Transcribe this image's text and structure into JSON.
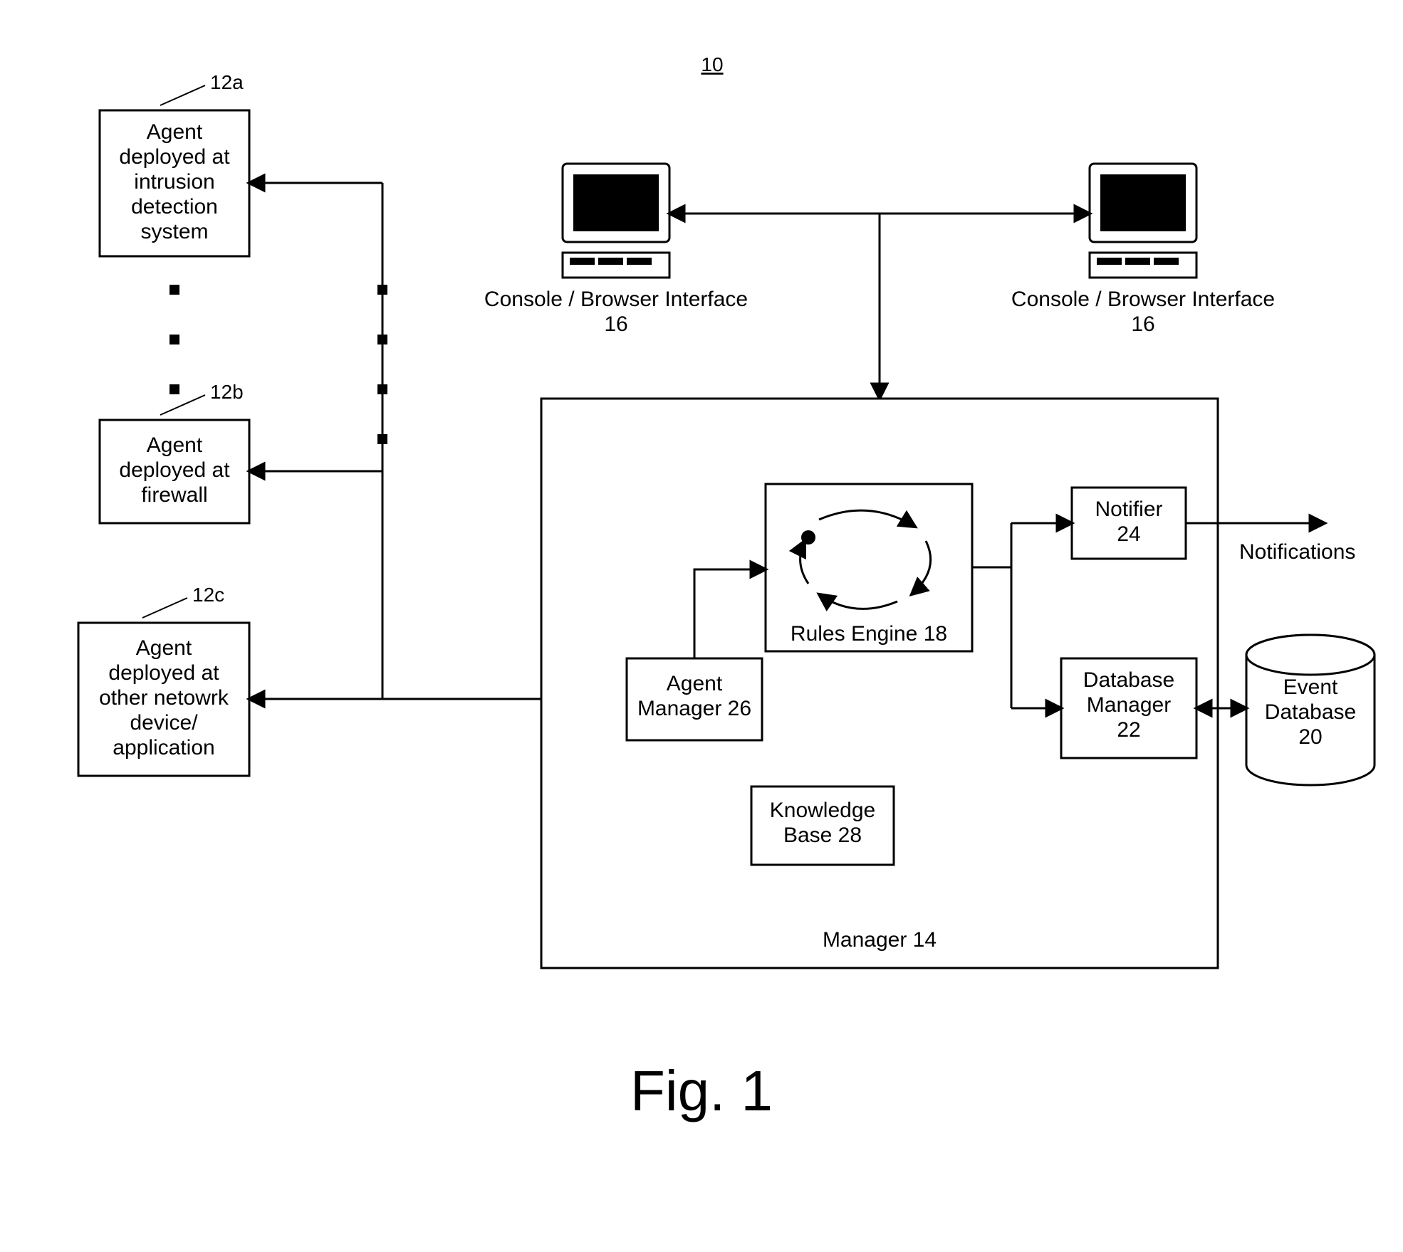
{
  "figure_num_ref": "10",
  "figure_caption": "Fig. 1",
  "agents": {
    "a": {
      "ref": "12a",
      "l1": "Agent",
      "l2": "deployed at",
      "l3": "intrusion",
      "l4": "detection",
      "l5": "system"
    },
    "b": {
      "ref": "12b",
      "l1": "Agent",
      "l2": "deployed at",
      "l3": "firewall"
    },
    "c": {
      "ref": "12c",
      "l1": "Agent",
      "l2": "deployed at",
      "l3": "other netowrk",
      "l4": "device/",
      "l5": "application"
    }
  },
  "consoles": {
    "left": {
      "l1": "Console / Browser Interface",
      "l2": "16"
    },
    "right": {
      "l1": "Console / Browser Interface",
      "l2": "16"
    }
  },
  "manager": {
    "label": "Manager 14",
    "agent_manager": {
      "l1": "Agent",
      "l2": "Manager 26"
    },
    "rules_engine": {
      "label": "Rules Engine 18"
    },
    "notifier": {
      "l1": "Notifier",
      "l2": "24"
    },
    "db_manager": {
      "l1": "Database",
      "l2": "Manager",
      "l3": "22"
    },
    "knowledge_base": {
      "l1": "Knowledge",
      "l2": "Base 28"
    }
  },
  "event_db": {
    "l1": "Event",
    "l2": "Database",
    "l3": "20"
  },
  "notifications_label": "Notifications"
}
